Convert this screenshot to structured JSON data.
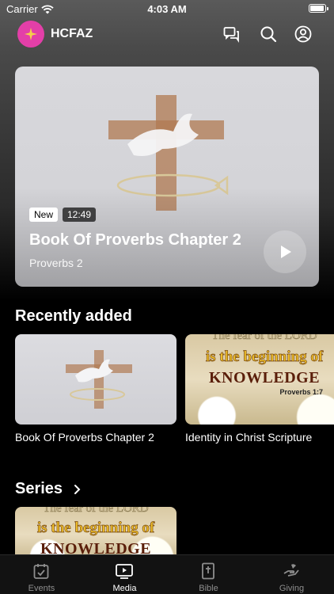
{
  "status_bar": {
    "carrier": "Carrier",
    "time": "4:03 AM",
    "battery_level": 1.0
  },
  "header": {
    "app_title": "HCFAZ",
    "icons": [
      "chat-icon",
      "search-icon",
      "profile-icon"
    ]
  },
  "featured": {
    "badge": "New",
    "duration": "12:49",
    "title": "Book Of Proverbs Chapter 2",
    "subtitle": "Proverbs 2"
  },
  "recently_added": {
    "heading": "Recently added",
    "items": [
      {
        "title": "Book Of Proverbs Chapter 2"
      },
      {
        "title": "Identity in Christ Scripture",
        "art": {
          "line1": "The fear of the LORD",
          "line2": "is the beginning of",
          "line3": "KNOWLEDGE",
          "ref": "Proverbs 1:7"
        }
      }
    ]
  },
  "series": {
    "heading": "Series",
    "art": {
      "line1": "The fear of the LORD",
      "line2": "is the beginning of",
      "line3": "KNOWLEDGE"
    }
  },
  "tabs": [
    {
      "label": "Events",
      "icon": "calendar-icon",
      "active": false
    },
    {
      "label": "Media",
      "icon": "play-screen-icon",
      "active": true
    },
    {
      "label": "Bible",
      "icon": "bible-icon",
      "active": false
    },
    {
      "label": "Giving",
      "icon": "giving-hand-icon",
      "active": false
    }
  ],
  "colors": {
    "accent": "#ffffff",
    "avatar_bg": "#e33fa8",
    "tab_inactive": "#8e8e8e",
    "tabbar_bg": "#121212"
  }
}
